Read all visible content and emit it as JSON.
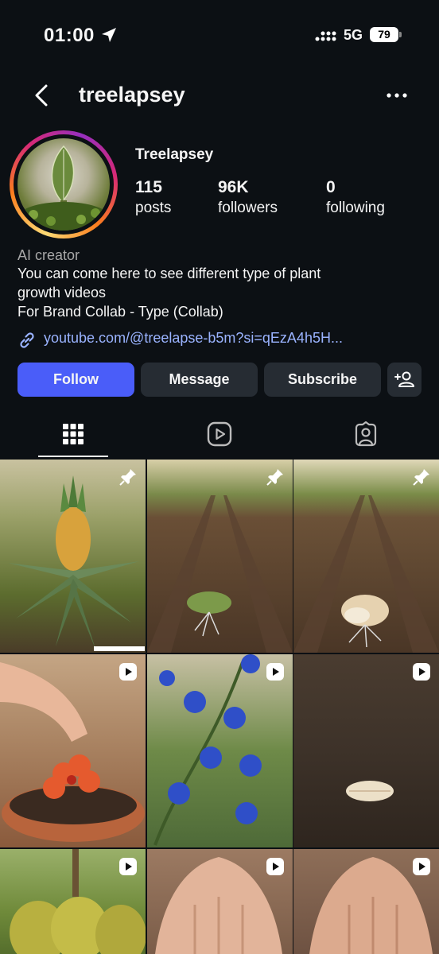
{
  "status_bar": {
    "time": "01:00",
    "network": "5G",
    "battery": "79"
  },
  "header": {
    "username": "treelapsey"
  },
  "profile": {
    "display_name": "Treelapsey",
    "stats": [
      {
        "value": "115",
        "label": "posts"
      },
      {
        "value": "96K",
        "label": "followers"
      },
      {
        "value": "0",
        "label": "following"
      }
    ],
    "category": "AI creator",
    "bio_lines": [
      "You can come here to see different type of plant",
      "growth videos",
      "For Brand Collab - Type (Collab)"
    ],
    "link": "youtube.com/@treelapse-b5m?si=qEzA4h5H..."
  },
  "actions": {
    "follow": "Follow",
    "message": "Message",
    "subscribe": "Subscribe"
  },
  "tabs": [
    "grid-icon",
    "reels-icon",
    "tagged-icon"
  ],
  "grid": [
    {
      "subject": "pineapple plant",
      "badge": "pin-icon",
      "bg": "#6d7a3a"
    },
    {
      "subject": "seed sprouting in soil rows",
      "badge": "pin-icon",
      "bg": "#6a4f36"
    },
    {
      "subject": "cracked seed in soil rows",
      "badge": "pin-icon",
      "bg": "#6c5238"
    },
    {
      "subject": "hand planting hibiscus",
      "badge": "reel-icon",
      "bg": "#8e5a3e"
    },
    {
      "subject": "blue butterfly pea flowers",
      "badge": "reel-icon",
      "bg": "#4e6a38"
    },
    {
      "subject": "seed on dark soil",
      "badge": "reel-icon",
      "bg": "#3d3229"
    },
    {
      "subject": "jackfruit on tree",
      "badge": "reel-icon",
      "bg": "#6f8a3a"
    },
    {
      "subject": "hands in soil",
      "badge": "reel-icon",
      "bg": "#8a6a55"
    },
    {
      "subject": "hands in soil",
      "badge": "reel-icon",
      "bg": "#7e604e"
    }
  ]
}
